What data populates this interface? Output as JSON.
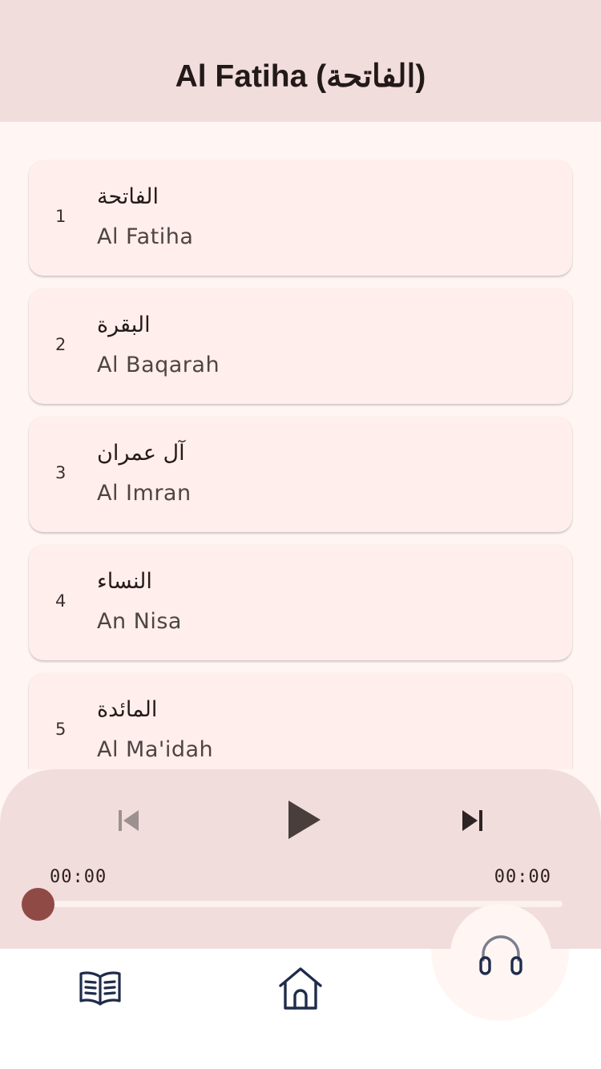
{
  "app_bar": {
    "title": "Al Fatiha (الفاتحة)"
  },
  "surahs": [
    {
      "number": "1",
      "arabic": "الفاتحة",
      "name": "Al Fatiha"
    },
    {
      "number": "2",
      "arabic": "البقرة",
      "name": "Al Baqarah"
    },
    {
      "number": "3",
      "arabic": "آل عمران",
      "name": "Al Imran"
    },
    {
      "number": "4",
      "arabic": "النساء",
      "name": "An Nisa"
    },
    {
      "number": "5",
      "arabic": "المائدة",
      "name": "Al Ma'idah"
    }
  ],
  "player": {
    "prev_icon": "skip-previous-icon",
    "play_icon": "play-icon",
    "next_icon": "skip-next-icon",
    "current_time": "00:00",
    "total_time": "00:00",
    "progress": 0
  },
  "nav": {
    "items": [
      {
        "icon": "open-book-icon"
      },
      {
        "icon": "home-icon"
      },
      {
        "icon": "headphones-icon",
        "active": true
      }
    ]
  },
  "colors": {
    "app_bar_bg": "#f1dddc",
    "page_bg": "#fff6f4",
    "card_bg": "#ffeeec",
    "slider_thumb": "#904a45",
    "nav_icon": "#1f2c4b"
  }
}
